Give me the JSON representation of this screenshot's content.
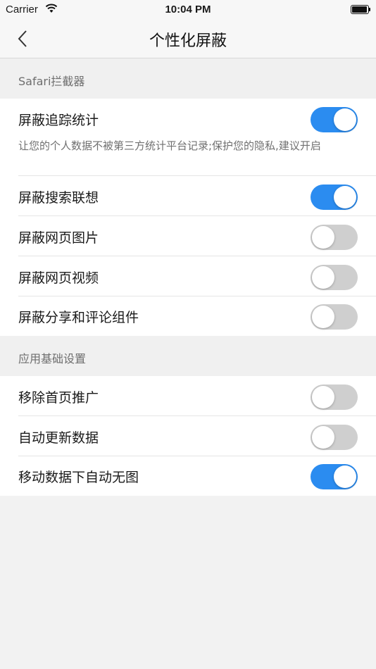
{
  "status_bar": {
    "carrier": "Carrier",
    "time": "10:04 PM"
  },
  "nav": {
    "title": "个性化屏蔽",
    "back_icon": "chevron-left-icon"
  },
  "colors": {
    "accent": "#2b8cf0",
    "switch_off": "#cfcfcf"
  },
  "sections": [
    {
      "header": "Safari拦截器",
      "rows": [
        {
          "label": "屏蔽追踪统计",
          "on": true,
          "description": "让您的个人数据不被第三方统计平台记录;保护您的隐私,建议开启"
        },
        {
          "label": "屏蔽搜索联想",
          "on": true
        },
        {
          "label": "屏蔽网页图片",
          "on": false
        },
        {
          "label": "屏蔽网页视频",
          "on": false
        },
        {
          "label": "屏蔽分享和评论组件",
          "on": false
        }
      ]
    },
    {
      "header": "应用基础设置",
      "rows": [
        {
          "label": "移除首页推广",
          "on": false
        },
        {
          "label": "自动更新数据",
          "on": false
        },
        {
          "label": "移动数据下自动无图",
          "on": true
        }
      ]
    }
  ]
}
